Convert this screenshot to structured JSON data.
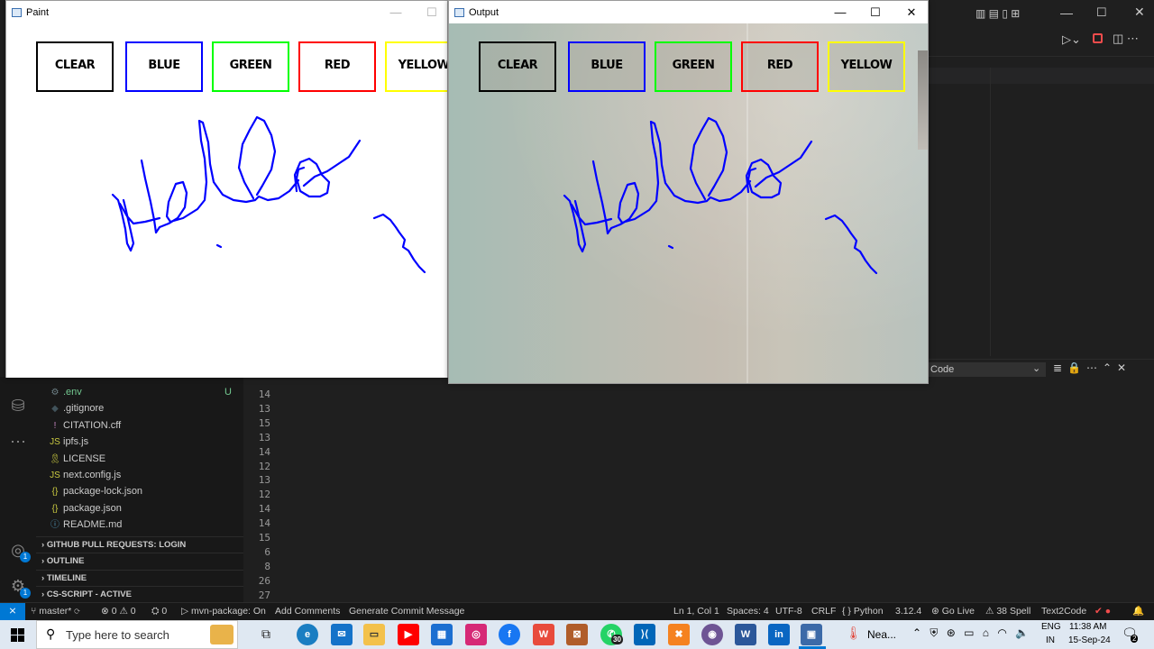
{
  "paint_window": {
    "title": "Paint"
  },
  "output_window": {
    "title": "Output"
  },
  "color_buttons": [
    {
      "label": "CLEAR",
      "color": "#000000"
    },
    {
      "label": "BLUE",
      "color": "#0000ff"
    },
    {
      "label": "GREEN",
      "color": "#00ff00"
    },
    {
      "label": "RED",
      "color": "#ff0000"
    },
    {
      "label": "YELLOW",
      "color": "#ffff00"
    }
  ],
  "stroke_color": "#0000ff",
  "explorer": {
    "files": [
      {
        "name": ".env",
        "icon": "gear-icon",
        "badge": "U"
      },
      {
        "name": ".gitignore",
        "icon": "git-icon"
      },
      {
        "name": "CITATION.cff",
        "icon": "exclamation-icon"
      },
      {
        "name": "ipfs.js",
        "icon": "js-icon"
      },
      {
        "name": "LICENSE",
        "icon": "license-icon"
      },
      {
        "name": "next.config.js",
        "icon": "js-icon"
      },
      {
        "name": "package-lock.json",
        "icon": "json-icon"
      },
      {
        "name": "package.json",
        "icon": "json-icon"
      },
      {
        "name": "README.md",
        "icon": "info-icon"
      }
    ],
    "sections": [
      "GITHUB PULL REQUESTS: LOGIN",
      "OUTLINE",
      "TIMELINE",
      "CS-SCRIPT - ACTIVE"
    ]
  },
  "editor": {
    "line_numbers": [
      "14",
      "13",
      "15",
      "13",
      "14",
      "12",
      "13",
      "12",
      "14",
      "14",
      "15",
      "6",
      "8",
      "26",
      "27"
    ]
  },
  "panel": {
    "dropdown_value": "Code"
  },
  "statusbar": {
    "branch": "master*",
    "problems": "⊗ 0 ⚠ 0",
    "ports": "⛭ 0",
    "mvn": "mvn-package: On",
    "add_comments": "Add Comments",
    "commit_msg": "Generate Commit Message",
    "position": "Ln 1, Col 1",
    "spaces": "Spaces: 4",
    "encoding": "UTF-8",
    "eol": "CRLF",
    "language": "Python",
    "version": "3.12.4",
    "golive": "Go Live",
    "spell": "38 Spell",
    "text2code": "Text2Code"
  },
  "taskbar": {
    "search_placeholder": "Type here to search",
    "whatsapp_badge": "30",
    "weather_text": "Nea...",
    "lang_top": "ENG",
    "lang_bottom": "IN",
    "time": "11:38 AM",
    "date": "15-Sep-24",
    "notif_count": "2"
  },
  "accent_blue": "#0078d4"
}
